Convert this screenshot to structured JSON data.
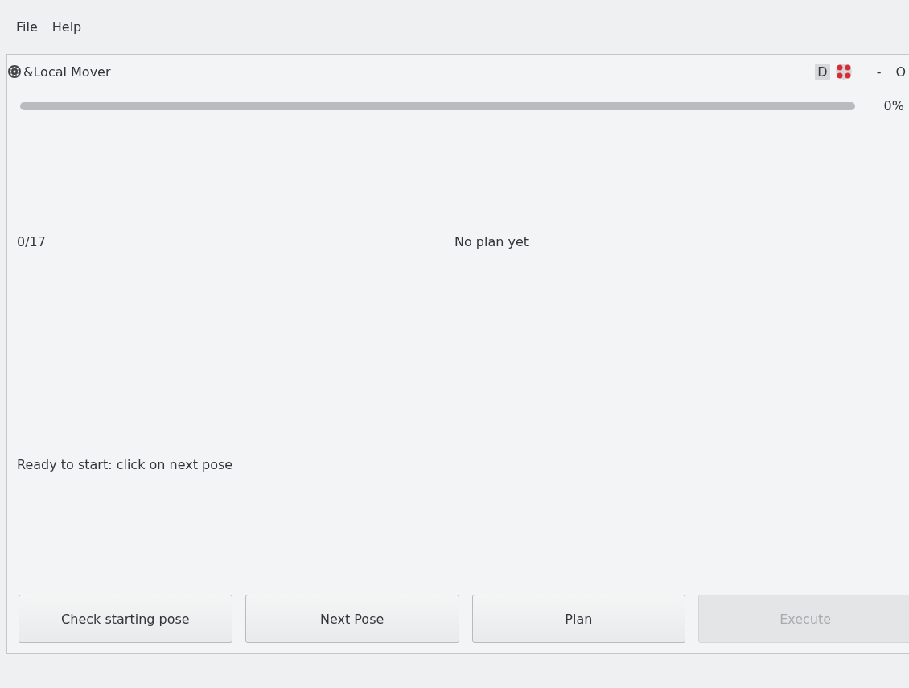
{
  "menu": [
    {
      "label": "File"
    },
    {
      "label": "Help"
    }
  ],
  "dock": {
    "title": "&Local Mover",
    "badge": "D",
    "controls": [
      "-",
      "O"
    ]
  },
  "progress": {
    "level": 0,
    "reading": "0%"
  },
  "counter": "0/17",
  "plan_status": "No plan yet",
  "message": "Ready to start: click on next pose",
  "buttons": [
    {
      "label": "Check starting pose",
      "disabled": false
    },
    {
      "label": "Next Pose",
      "disabled": false
    },
    {
      "label": "Plan",
      "disabled": false
    },
    {
      "label": "Execute",
      "disabled": true
    }
  ]
}
